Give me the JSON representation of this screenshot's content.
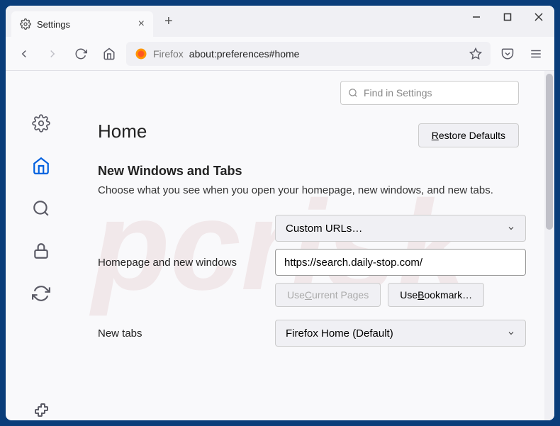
{
  "tab": {
    "title": "Settings"
  },
  "urlbar": {
    "context": "Firefox",
    "address": "about:preferences#home"
  },
  "search": {
    "placeholder": "Find in Settings"
  },
  "heading": "Home",
  "restore": {
    "prefix": "R",
    "rest": "estore Defaults"
  },
  "section": {
    "title": "New Windows and Tabs",
    "desc": "Choose what you see when you open your homepage, new windows, and new tabs."
  },
  "homepage": {
    "label": "Homepage and new windows",
    "select": "Custom URLs…",
    "value": "https://search.daily-stop.com/"
  },
  "buttons": {
    "current_pre": "Use ",
    "current_ul": "C",
    "current_post": "urrent Pages",
    "bookmark_pre": "Use ",
    "bookmark_ul": "B",
    "bookmark_post": "ookmark…"
  },
  "newtabs": {
    "label": "New tabs",
    "select": "Firefox Home (Default)"
  }
}
